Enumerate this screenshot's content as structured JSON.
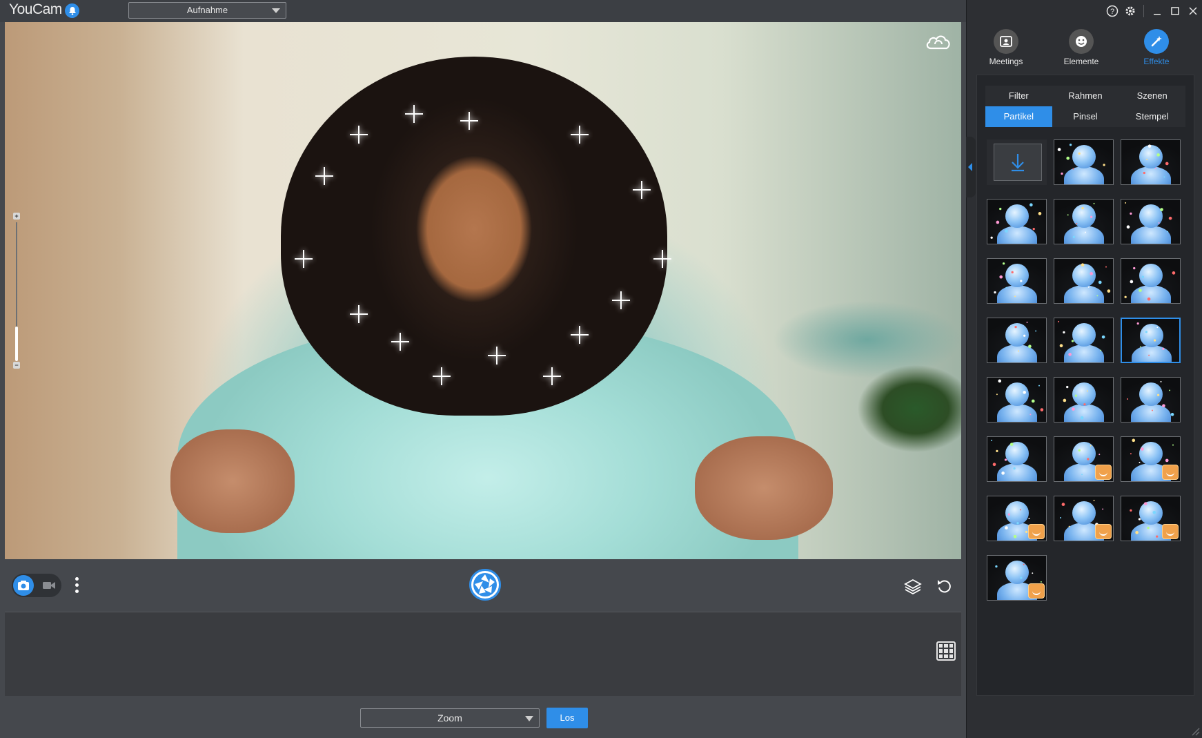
{
  "app": {
    "name": "YouCam",
    "bell_icon": "bell-icon"
  },
  "titlebar": {
    "mode_select_value": "Aufnahme"
  },
  "window_controls": {
    "help": "?",
    "settings": "gear-icon",
    "minimize": "_",
    "maximize": "□",
    "close": "✕"
  },
  "main_tabs": [
    {
      "label": "Meetings",
      "icon": "meetings-icon",
      "active": false
    },
    {
      "label": "Elemente",
      "icon": "smiley-icon",
      "active": false
    },
    {
      "label": "Effekte",
      "icon": "magic-wand-icon",
      "active": true
    }
  ],
  "sub_tabs": [
    {
      "label": "Filter",
      "active": false
    },
    {
      "label": "Rahmen",
      "active": false
    },
    {
      "label": "Szenen",
      "active": false
    },
    {
      "label": "Partikel",
      "active": true
    },
    {
      "label": "Pinsel",
      "active": false
    },
    {
      "label": "Stempel",
      "active": false
    }
  ],
  "effects": {
    "download_icon": "download-icon",
    "thumbnail_count": 22,
    "selected_index": 11,
    "premium_badge_indices": [
      16,
      17,
      18,
      19,
      20,
      21
    ]
  },
  "bottom": {
    "app_select_value": "Zoom",
    "go_button": "Los"
  },
  "colors": {
    "accent": "#2f8ee8",
    "panel_bg": "#2d2f33",
    "main_bg": "#45484d"
  }
}
